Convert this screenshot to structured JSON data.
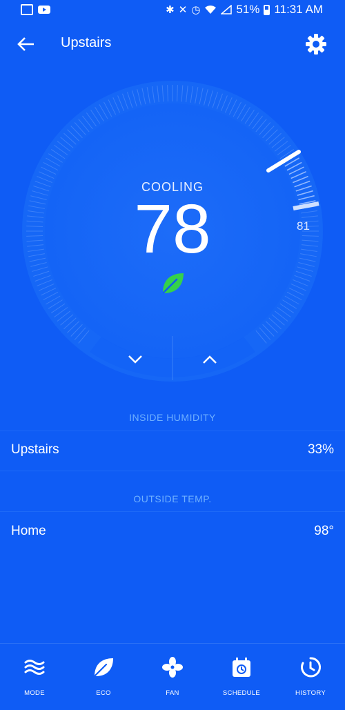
{
  "status_bar": {
    "battery": "51%",
    "time": "11:31 AM"
  },
  "header": {
    "title": "Upstairs"
  },
  "thermostat": {
    "state": "COOLING",
    "current_temp": "78",
    "setpoint": "81"
  },
  "humidity": {
    "section_label": "INSIDE HUMIDITY",
    "location": "Upstairs",
    "value": "33%"
  },
  "outside": {
    "section_label": "OUTSIDE TEMP.",
    "location": "Home",
    "value": "98°"
  },
  "nav": {
    "items": [
      {
        "label": "MODE",
        "icon": "mode-waves-icon"
      },
      {
        "label": "ECO",
        "icon": "eco-leaf-icon"
      },
      {
        "label": "FAN",
        "icon": "fan-icon"
      },
      {
        "label": "SCHEDULE",
        "icon": "schedule-calendar-icon"
      },
      {
        "label": "HISTORY",
        "icon": "history-clock-icon"
      }
    ]
  },
  "colors": {
    "background": "#0f5cf5",
    "leaf": "#35d14b",
    "section_label": "#6fb0ff"
  }
}
